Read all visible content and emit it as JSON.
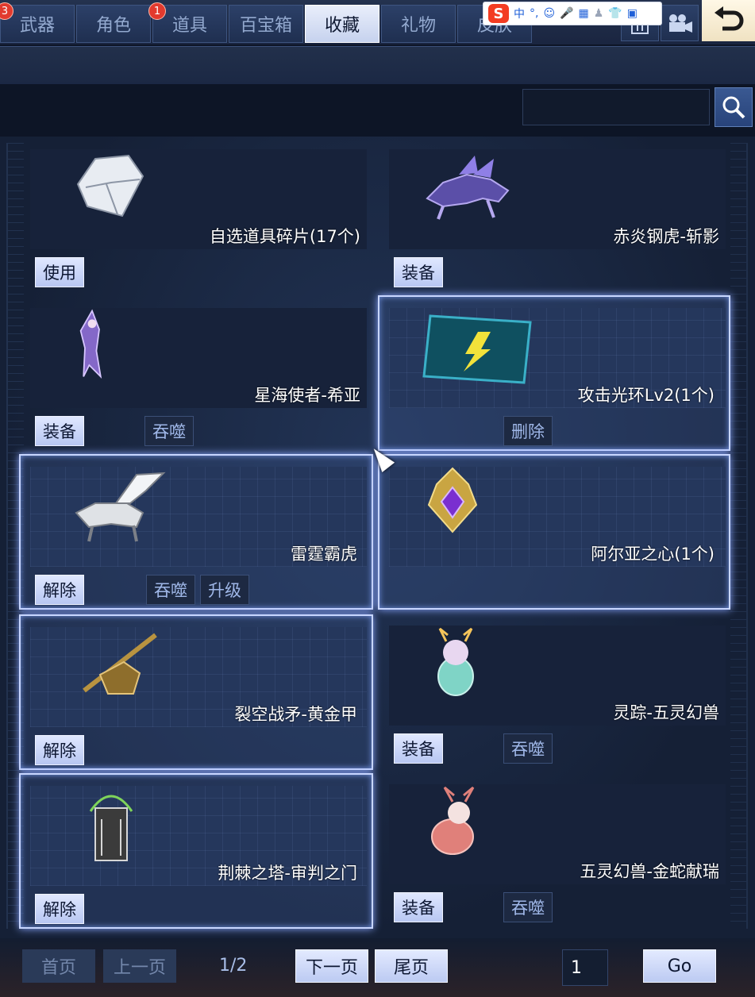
{
  "tabs": [
    {
      "label": "武器",
      "badge": "3"
    },
    {
      "label": "角色",
      "badge": ""
    },
    {
      "label": "道具",
      "badge": "1"
    },
    {
      "label": "百宝箱",
      "badge": ""
    },
    {
      "label": "收藏",
      "badge": ""
    },
    {
      "label": "礼物",
      "badge": ""
    },
    {
      "label": "皮肤",
      "badge": ""
    }
  ],
  "ime_toolbar": {
    "logo": "S",
    "mode": "中",
    "punct": "°,"
  },
  "search": {
    "placeholder": ""
  },
  "items": [
    {
      "name": "自选道具碎片(17个)",
      "primary": "使用",
      "secondary": []
    },
    {
      "name": "赤炎钢虎-斩影",
      "primary": "装备",
      "secondary": []
    },
    {
      "name": "星海使者-希亚",
      "primary": "装备",
      "secondary": [
        "吞噬"
      ]
    },
    {
      "name": "攻击光环Lv2(1个)",
      "primary": "",
      "secondary": [
        "删除"
      ]
    },
    {
      "name": "雷霆霸虎",
      "primary": "解除",
      "secondary": [
        "吞噬",
        "升级"
      ]
    },
    {
      "name": "阿尔亚之心(1个)",
      "primary": "",
      "secondary": []
    },
    {
      "name": "裂空战矛-黄金甲",
      "primary": "解除",
      "secondary": []
    },
    {
      "name": "灵踪-五灵幻兽",
      "primary": "装备",
      "secondary": [
        "吞噬"
      ]
    },
    {
      "name": "荆棘之塔-审判之门",
      "primary": "解除",
      "secondary": []
    },
    {
      "name": "五灵幻兽-金蛇献瑞",
      "primary": "装备",
      "secondary": [
        "吞噬"
      ]
    }
  ],
  "pager": {
    "first": "首页",
    "prev": "上一页",
    "info": "1/2",
    "next": "下一页",
    "last": "尾页",
    "page_input": "1",
    "go": "Go"
  }
}
